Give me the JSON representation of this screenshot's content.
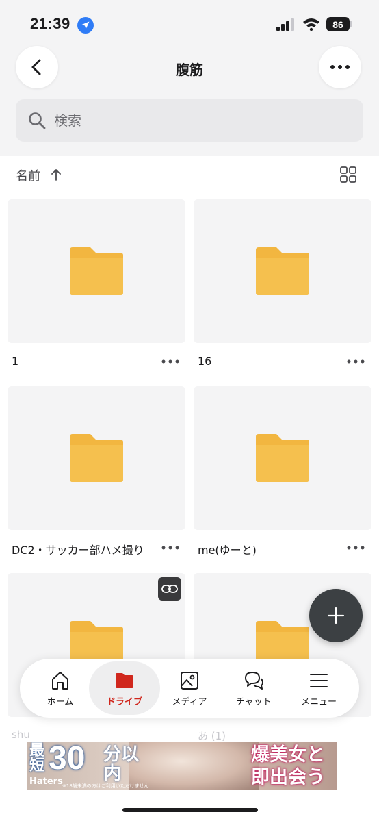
{
  "status_bar": {
    "time": "21:39",
    "battery": "86"
  },
  "header": {
    "title": "腹筋",
    "back_icon": "chevron-left-icon",
    "more_icon": "ellipsis-icon"
  },
  "search": {
    "placeholder": "検索"
  },
  "sort": {
    "label": "名前",
    "direction": "ascending"
  },
  "folders": [
    {
      "name": "1",
      "shared_link": false
    },
    {
      "name": "16",
      "shared_link": false
    },
    {
      "name": "DC2・サッカー部ハメ撮り",
      "shared_link": false
    },
    {
      "name": "me(ゆーと)",
      "shared_link": false
    },
    {
      "name": "shu",
      "shared_link": true
    },
    {
      "name": "あ (1)",
      "shared_link": false
    }
  ],
  "bottom_nav": [
    {
      "label": "ホーム",
      "icon": "home-icon",
      "active": false
    },
    {
      "label": "ドライブ",
      "icon": "folder-icon",
      "active": true
    },
    {
      "label": "メディア",
      "icon": "image-icon",
      "active": false
    },
    {
      "label": "チャット",
      "icon": "chat-icon",
      "active": false
    },
    {
      "label": "メニュー",
      "icon": "menu-icon",
      "active": false
    }
  ],
  "ad": {
    "left_top": "最短",
    "big_number": "30",
    "unit": "分以内",
    "brand": "Haters",
    "fine_print": "※18歳未満の方はご利用いただけません",
    "right_text": "爆美女と即出会う"
  },
  "colors": {
    "accent": "#d0271d",
    "folder": "#f2b640",
    "fab": "#3c4043"
  }
}
